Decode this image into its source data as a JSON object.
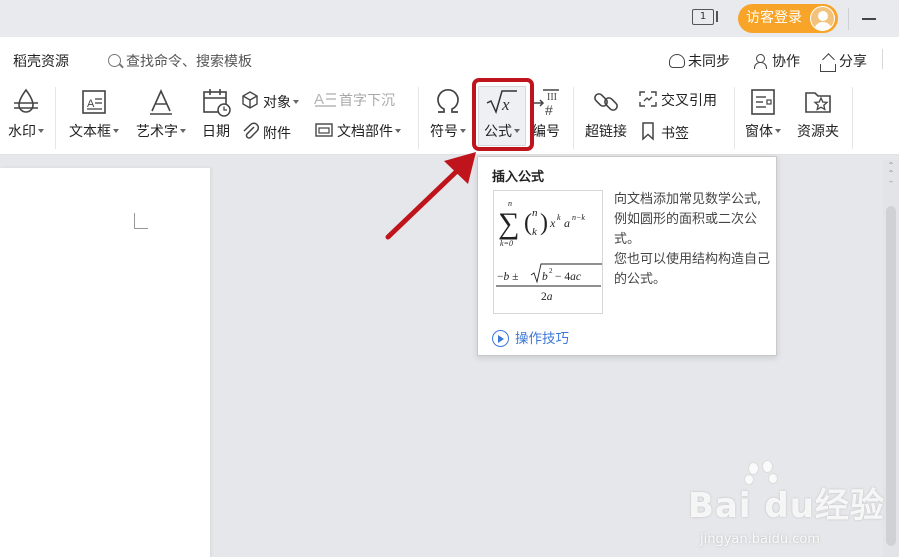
{
  "titlebar": {
    "window_badge": "1",
    "login_label": "访客登录"
  },
  "menubar": {
    "resources": "稻壳资源",
    "search_placeholder": "查找命令、搜索模板",
    "sync": "未同步",
    "collaborate": "协作",
    "share": "分享"
  },
  "ribbon": {
    "watermark": "水印",
    "textbox": "文本框",
    "wordart": "艺术字",
    "date": "日期",
    "object": "对象",
    "attachment": "附件",
    "dropcap": "首字下沉",
    "docparts": "文档部件",
    "symbol": "符号",
    "formula": "公式",
    "numbering": "编号",
    "hyperlink": "超链接",
    "crossref": "交叉引用",
    "bookmark": "书签",
    "window": "窗体",
    "resource_folder": "资源夹"
  },
  "tooltip": {
    "title": "插入公式",
    "description_1": "向文档添加常见数学公式, 例如圆形的面积或二次公式。",
    "description_2": "您也可以使用结构构造自己的公式。",
    "link": "操作技巧"
  },
  "watermark_brand": {
    "main": "Bai du经验",
    "sub": "jingyan.baidu.com"
  },
  "colors": {
    "login_orange": "#f7a428",
    "highlight_red": "#c0141c",
    "link_blue": "#3c78d8"
  }
}
